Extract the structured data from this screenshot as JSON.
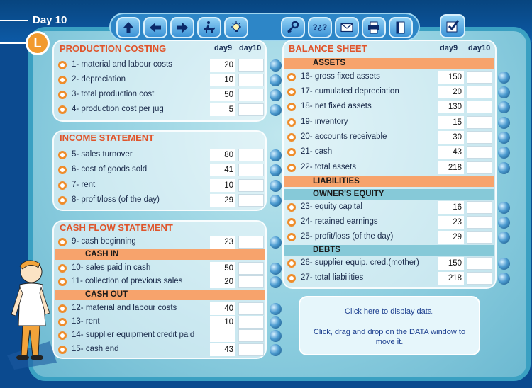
{
  "header": {
    "day_label": "Day 10",
    "logo_letter": "L"
  },
  "toolbar": {
    "buttons": [
      {
        "name": "up-arrow-icon"
      },
      {
        "name": "left-arrow-icon"
      },
      {
        "name": "right-arrow-icon"
      },
      {
        "name": "horse-rider-icon"
      },
      {
        "name": "lightbulb-icon"
      },
      {
        "name": "key-icon"
      },
      {
        "name": "help-icon",
        "text": "?¿?"
      },
      {
        "name": "mail-icon"
      },
      {
        "name": "printer-icon"
      },
      {
        "name": "book-icon"
      }
    ],
    "check": {
      "name": "check-icon"
    }
  },
  "col_headers": {
    "day9": "day9",
    "day10": "day10"
  },
  "production": {
    "title": "PRODUCTION COSTING",
    "rows": [
      {
        "label": "1-  material and labour costs",
        "day9": "20"
      },
      {
        "label": "2-  depreciation",
        "day9": "10"
      },
      {
        "label": "3-  total production cost",
        "day9": "50"
      },
      {
        "label": "4-  production cost per jug",
        "day9": "5"
      }
    ]
  },
  "income": {
    "title": "INCOME STATEMENT",
    "rows": [
      {
        "label": "5-  sales turnover",
        "day9": "80"
      },
      {
        "label": "6-  cost of goods sold",
        "day9": "41"
      },
      {
        "label": "7-  rent",
        "day9": "10"
      },
      {
        "label": "8-  profit/loss (of the day)",
        "day9": "29"
      }
    ]
  },
  "cashflow": {
    "title": "CASH FLOW STATEMENT",
    "cash_in": "CASH IN",
    "cash_out": "CASH OUT",
    "rows": [
      {
        "label": "9-  cash beginning",
        "day9": "23"
      },
      {
        "label": "10-  sales paid in cash",
        "day9": "50"
      },
      {
        "label": "11-  collection of previous sales",
        "day9": "20"
      },
      {
        "label": "12-  material and labour costs",
        "day9": "40"
      },
      {
        "label": "13-  rent",
        "day9": "10"
      },
      {
        "label": "14-  supplier equipment credit paid",
        "day9": ""
      },
      {
        "label": "15-  cash end",
        "day9": "43"
      }
    ]
  },
  "balance": {
    "title": "BALANCE SHEET",
    "assets": "ASSETS",
    "liabilities": "LIABILITIES",
    "equity": "OWNER'S EQUITY",
    "debts": "DEBTS",
    "rows": [
      {
        "label": "16-  gross fixed assets",
        "day9": "150"
      },
      {
        "label": "17-  cumulated depreciation",
        "day9": "20"
      },
      {
        "label": "18-  net fixed assets",
        "day9": "130"
      },
      {
        "label": "19-  inventory",
        "day9": "15"
      },
      {
        "label": "20-  accounts receivable",
        "day9": "30"
      },
      {
        "label": "21-  cash",
        "day9": "43"
      },
      {
        "label": "22-  total assets",
        "day9": "218"
      },
      {
        "label": "23-  equity capital",
        "day9": "16"
      },
      {
        "label": "24-  retained earnings",
        "day9": "23"
      },
      {
        "label": "25-  profit/loss (of the day)",
        "day9": "29"
      },
      {
        "label": "26-  supplier equip. cred.(mother)",
        "day9": "150"
      },
      {
        "label": "27-  total liabilities",
        "day9": "218"
      }
    ]
  },
  "info": {
    "line1": "Click here to display data.",
    "line2": "Click, drag and drop on the DATA window to move it."
  },
  "colors": {
    "accent_orange": "#ef8c2a",
    "title_orange": "#e0542a",
    "panel_blue": "#8fcfe0",
    "header_blue": "#0b4a8f"
  }
}
